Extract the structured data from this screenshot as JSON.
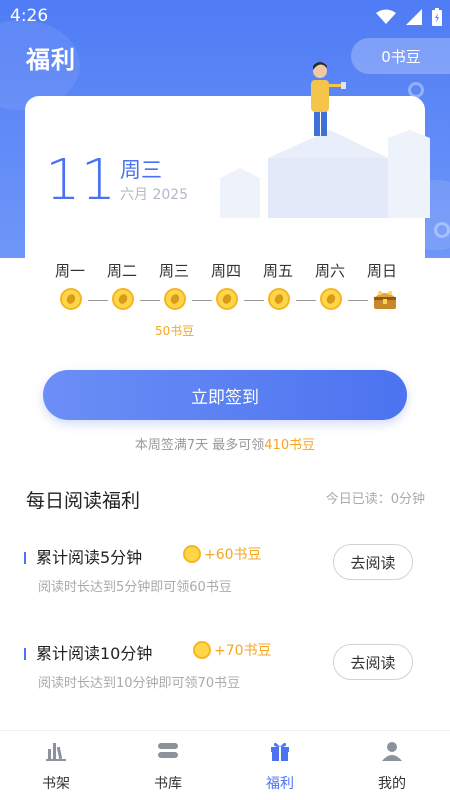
{
  "statusbar": {
    "time": "4:26"
  },
  "header": {
    "title": "福利",
    "coin_badge": "0书豆"
  },
  "date_card": {
    "day": "11",
    "weekday": "周三",
    "month_year": "六月 2025"
  },
  "week": {
    "days": [
      "周一",
      "周二",
      "周三",
      "周四",
      "周五",
      "周六",
      "周日"
    ],
    "reward_label": "50书豆"
  },
  "signin": {
    "button_label": "立即签到",
    "hint_prefix": "本周签满7天 最多可领",
    "hint_highlight": "410书豆"
  },
  "reading": {
    "section_title": "每日阅读福利",
    "today_read": "今日已读：0分钟",
    "tasks": [
      {
        "title": "累计阅读5分钟",
        "reward": "+60书豆",
        "desc": "阅读时长达到5分钟即可领60书豆",
        "button": "去阅读"
      },
      {
        "title": "累计阅读10分钟",
        "reward": "+70书豆",
        "desc": "阅读时长达到10分钟即可领70书豆",
        "button": "去阅读"
      }
    ]
  },
  "tabbar": {
    "tabs": [
      {
        "label": "书架",
        "icon": "bookshelf-icon"
      },
      {
        "label": "书库",
        "icon": "library-icon"
      },
      {
        "label": "福利",
        "icon": "gift-icon"
      },
      {
        "label": "我的",
        "icon": "profile-icon"
      }
    ],
    "active_index": 2
  },
  "colors": {
    "accent": "#4c73f0",
    "coin": "#f5a623",
    "header": "#5b86f6"
  }
}
